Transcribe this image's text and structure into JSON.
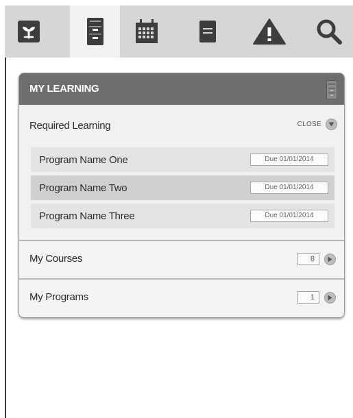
{
  "toolbar": {
    "tabs": [
      {
        "icon": "plant-icon",
        "active": false
      },
      {
        "icon": "cabinet-icon",
        "active": true
      },
      {
        "icon": "calendar-icon",
        "active": false
      },
      {
        "icon": "notepad-icon",
        "active": false
      },
      {
        "icon": "alert-icon",
        "active": false
      },
      {
        "icon": "search-icon",
        "active": false
      }
    ]
  },
  "panel": {
    "title": "MY LEARNING",
    "required": {
      "label": "Required Learning",
      "close_label": "CLOSE",
      "programs": [
        {
          "name": "Program Name One",
          "due": "Due 01/01/2014"
        },
        {
          "name": "Program Name Two",
          "due": "Due 01/01/2014"
        },
        {
          "name": "Program Name Three",
          "due": "Due 01/01/2014"
        }
      ]
    },
    "courses": {
      "label": "My Courses",
      "count": "8"
    },
    "programs": {
      "label": "My Programs",
      "count": "1"
    }
  },
  "colors": {
    "toolbar_bg": "#d6d6d6",
    "active_tab_bg": "#f2f2f2",
    "icon_dark": "#3d3d3d",
    "header_bg": "#6e6e6e"
  }
}
